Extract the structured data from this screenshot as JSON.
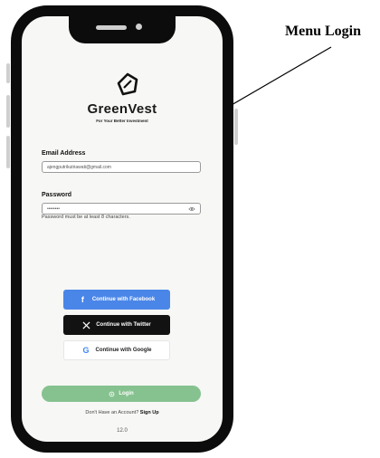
{
  "annotation": {
    "label": "Menu Login"
  },
  "brand": {
    "name": "GreenVest",
    "tagline": "For Your Better Investment"
  },
  "form": {
    "email_label": "Email Address",
    "email_value": "ajengputrikutriawati@gmail.com",
    "password_label": "Password",
    "password_value": "••••••••",
    "password_hint": "Password must be at least 8 characters."
  },
  "social": {
    "facebook_label": "Continue with Facebook",
    "twitter_label": "Continue with Twitter",
    "google_label": "Continue with Google"
  },
  "login": {
    "label": "Login"
  },
  "signup": {
    "prompt": "Don't Have an Account?",
    "link": "Sign Up"
  },
  "version": "12.0",
  "colors": {
    "facebook": "#4a86e8",
    "twitter": "#121212",
    "login": "#86c28f",
    "screen": "#f7f7f5"
  },
  "icons": [
    "greenvest-logo-icon",
    "eye-icon",
    "facebook-icon",
    "x-icon",
    "google-icon",
    "login-icon"
  ]
}
